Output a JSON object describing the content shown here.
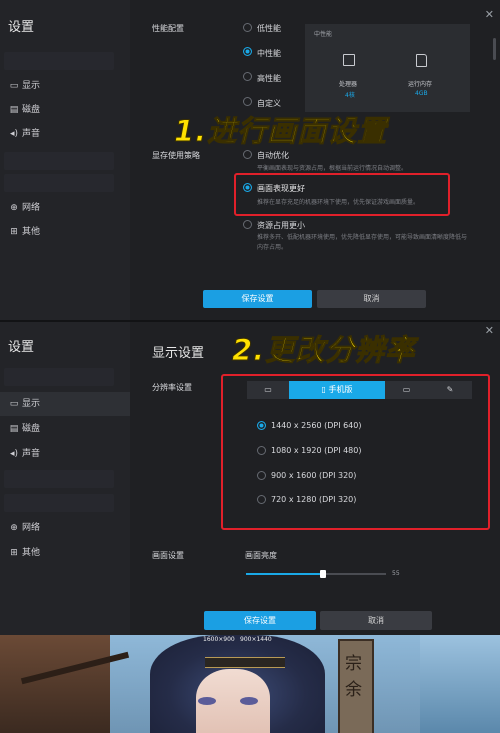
{
  "panel1": {
    "title": "设置",
    "sidebar": [
      {
        "icon": "▭",
        "label": "显示"
      },
      {
        "icon": "▤",
        "label": "磁盘"
      },
      {
        "icon": "◂)",
        "label": "声音"
      },
      {
        "icon": "⊕",
        "label": "网络"
      },
      {
        "icon": "⊞",
        "label": "其他"
      }
    ],
    "perf_label": "性能配置",
    "perf_options": [
      "低性能",
      "中性能",
      "高性能",
      "自定义"
    ],
    "perf_selected": 1,
    "perf_box": {
      "title": "中性能",
      "cpu_label": "处理器",
      "cpu_value": "4核",
      "mem_label": "运行内存",
      "mem_value": "4GB"
    },
    "vram_label": "显存使用策略",
    "vram_options": [
      {
        "title": "自动优化",
        "desc": "平衡画面表现与资源占用，根据当前运行情况自动调整。"
      },
      {
        "title": "画面表现更好",
        "desc": "推荐在显存充足的机器环境下使用，优先保证游戏画面质量。"
      },
      {
        "title": "资源占用更小",
        "desc": "推荐多开、低配机器环境使用，优先降低显存使用，可能导致画面清晰度降低与内存占用。"
      }
    ],
    "vram_selected": 1,
    "save": "保存设置",
    "cancel": "取消",
    "annotation": "1.进行画面设置"
  },
  "panel2": {
    "title": "设置",
    "header": "显示设置",
    "sidebar": [
      {
        "icon": "▭",
        "label": "显示"
      },
      {
        "icon": "▤",
        "label": "磁盘"
      },
      {
        "icon": "◂)",
        "label": "声音"
      },
      {
        "icon": "⊕",
        "label": "网络"
      },
      {
        "icon": "⊞",
        "label": "其他"
      }
    ],
    "res_label": "分辨率设置",
    "tabs": [
      {
        "icon": "▭",
        "label": ""
      },
      {
        "icon": "▯",
        "label": "手机版"
      },
      {
        "icon": "▭",
        "label": ""
      },
      {
        "icon": "✎",
        "label": ""
      }
    ],
    "tab_active": 1,
    "resolutions": [
      "1440 x 2560 (DPI 640)",
      "1080 x 1920 (DPI 480)",
      "900 x 1600 (DPI 320)",
      "720 x 1280 (DPI 320)"
    ],
    "res_selected": 0,
    "screen_label": "画面设置",
    "brightness_label": "画面亮度",
    "brightness_value": "55",
    "save": "保存设置",
    "cancel": "取消",
    "annotation": "2.更改分辨率"
  },
  "bottom": {
    "res_tag_1": "1600×900",
    "res_tag_2": "900×1440",
    "sign_text": "宗 余"
  },
  "colors": {
    "accent": "#1aa9e8",
    "annotation": "#ffe100",
    "box": "#e0202a"
  }
}
